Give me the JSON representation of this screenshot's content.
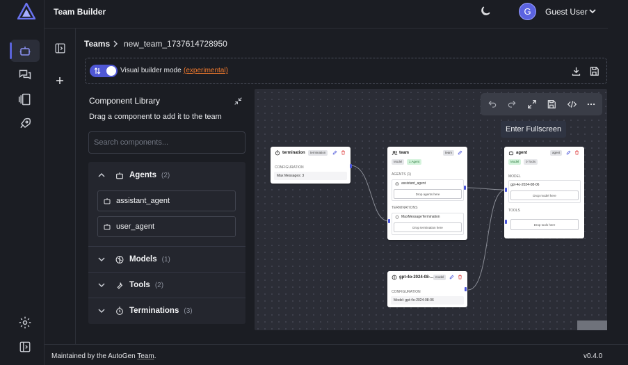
{
  "app": {
    "title": "Team Builder",
    "user_name": "Guest User",
    "avatar_initial": "G",
    "version": "v0.4.0"
  },
  "breadcrumb": {
    "root": "Teams",
    "current": "new_team_1737614728950"
  },
  "toolbar": {
    "mode_label": "Visual builder mode",
    "mode_link": "(experimental)"
  },
  "library": {
    "title": "Component Library",
    "subtitle": "Drag a component to add it to the team",
    "search_placeholder": "Search components...",
    "sections": {
      "agents": {
        "label": "Agents",
        "count": "(2)",
        "items": [
          "assistant_agent",
          "user_agent"
        ]
      },
      "models": {
        "label": "Models",
        "count": "(1)"
      },
      "tools": {
        "label": "Tools",
        "count": "(2)"
      },
      "terminations": {
        "label": "Terminations",
        "count": "(3)"
      }
    }
  },
  "canvas": {
    "tooltip": "Enter Fullscreen",
    "nodes": {
      "termination": {
        "title": "termination",
        "badge": "termination",
        "section": "CONFIGURATION",
        "value": "Max Messages: 3"
      },
      "team": {
        "title": "team",
        "badge": "team",
        "chip_model": "Model",
        "chip_agent": "1 Agent",
        "agents_label": "AGENTS (1)",
        "agent_item": "assistant_agent",
        "drop_agents": "Drop agents here",
        "terminations_label": "TERMINATIONS",
        "termination_item": "MaxMessageTermination",
        "drop_termination": "Drop termination here"
      },
      "agent": {
        "title": "agent",
        "badge": "agent",
        "chip_model": "Model",
        "chip_tools": "0 Tools",
        "model_label": "MODEL",
        "model_value": "gpt-4o-2024-08-06",
        "drop_model": "Drop model here",
        "tools_label": "TOOLS",
        "drop_tools": "Drop tools here"
      },
      "model": {
        "title": "gpt-4o-2024-08-...",
        "badge": "model",
        "section": "CONFIGURATION",
        "value": "Model: gpt-4o-2024-08-06"
      }
    }
  },
  "footer": {
    "prefix": "Maintained by the AutoGen ",
    "link": "Team",
    "suffix": "."
  },
  "colors": {
    "accent": "#5b63e0",
    "link": "#f27a2d",
    "canvas_bg": "#2b2d36",
    "delete": "#e04848"
  }
}
